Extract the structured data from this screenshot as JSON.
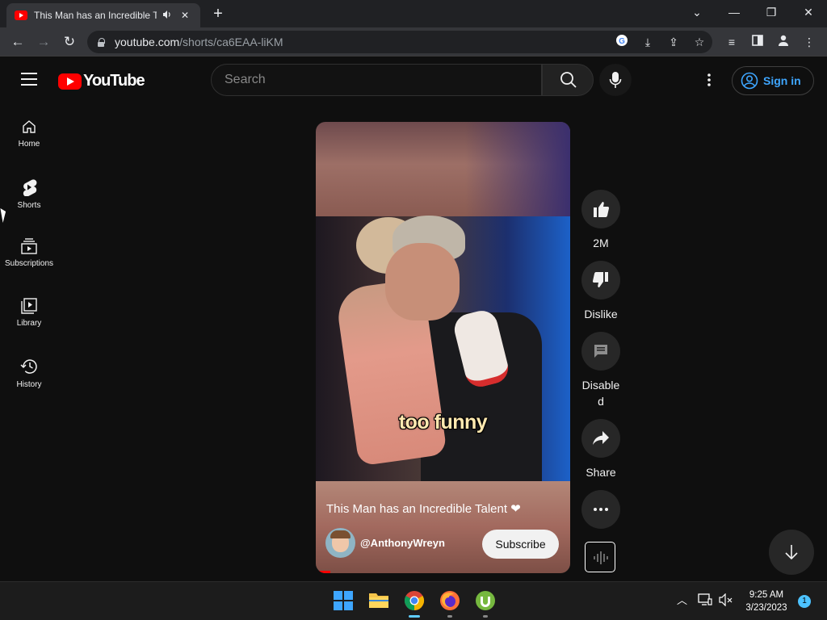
{
  "browser": {
    "tab_title": "This Man has an Incredible T",
    "url_host": "youtube.com",
    "url_path": "/shorts/ca6EAA-liKM"
  },
  "youtube": {
    "logo_text": "YouTube",
    "search_placeholder": "Search",
    "signin_label": "Sign in",
    "sidebar": [
      {
        "label": "Home",
        "icon": "home-icon"
      },
      {
        "label": "Shorts",
        "icon": "shorts-icon"
      },
      {
        "label": "Subscriptions",
        "icon": "subscriptions-icon"
      },
      {
        "label": "Library",
        "icon": "library-icon"
      },
      {
        "label": "History",
        "icon": "history-icon"
      }
    ]
  },
  "short": {
    "caption": "too funny",
    "title": "This Man has an Incredible Talent ❤",
    "channel": "@AnthonyWreyn",
    "subscribe_label": "Subscribe",
    "actions": {
      "likes": "2M",
      "dislike": "Dislike",
      "comments_line1": "Disable",
      "comments_line2": "d",
      "share": "Share"
    }
  },
  "taskbar": {
    "time": "9:25 AM",
    "date": "3/23/2023",
    "notifications": "1"
  },
  "colors": {
    "accent_red": "#ff0000",
    "signin_blue": "#3ea6ff"
  }
}
